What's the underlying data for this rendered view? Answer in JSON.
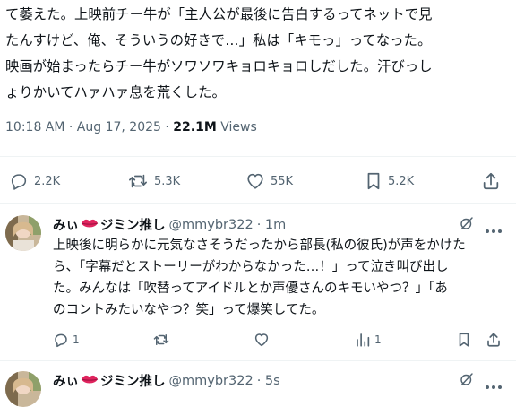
{
  "main_tweet": {
    "lines": [
      "て萎えた。上映前チー牛が「主人公が最後に告白するってネットで見",
      "たんすけど、俺、そういうの好きで…」私は「キモっ」ってなった。",
      "映画が始まったらチー牛がソワソワキョロキョロしだした。汗びっし",
      "ょりかいてハァハァ息を荒くした。"
    ],
    "time": "10:18 AM · Aug 17, 2025 · ",
    "views_count": "22.1M",
    "views_label": " Views",
    "actions": {
      "replies": "2.2K",
      "retweets": "5.3K",
      "likes": "55K",
      "bookmarks": "5.2K"
    }
  },
  "reply1": {
    "name_prefix": "みぃ",
    "name_suffix": "ジミン推し",
    "handle": "@mmybr322",
    "time": "· 1m",
    "lines": [
      "上映後に明らかに元気なさそうだったから部長(私の彼氏)が声をかけた",
      "ら、「字幕だとストーリーがわからなかった…！」って泣き叫び出し",
      "た。みんなは「吹替ってアイドルとか声優さんのキモいやつ？」「あ",
      "のコントみたいなやつ？笑」って爆笑してた。"
    ],
    "replies": "1",
    "views": "1"
  },
  "reply2": {
    "name_prefix": "みぃ",
    "name_suffix": "ジミン推し",
    "handle": "@mmybr322",
    "time": "· 5s"
  },
  "colors": {
    "text": "#0f1419",
    "secondary": "#536471",
    "divider": "#eff3f4",
    "lips": "#e0245e"
  }
}
